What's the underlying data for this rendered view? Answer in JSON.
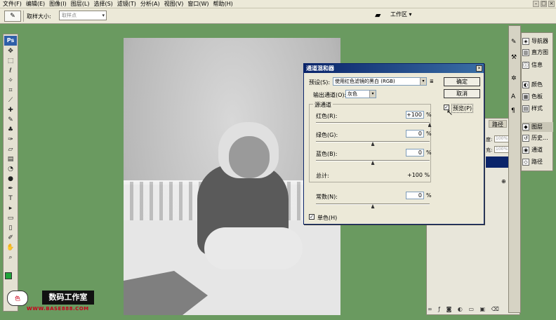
{
  "menu": {
    "items": [
      "文件(F)",
      "编辑(E)",
      "图像(I)",
      "图层(L)",
      "选择(S)",
      "滤镜(T)",
      "分析(A)",
      "视图(V)",
      "窗口(W)",
      "帮助(H)"
    ]
  },
  "options_bar": {
    "sample_label": "取样大小:",
    "sample_value": "取样点",
    "workspace_label": "工作区 ▾"
  },
  "toolbox": {
    "logo": "Ps",
    "foreground_color": "#1fa33a"
  },
  "watermark": {
    "text": "数码工作室",
    "url": "WWW.BASE888.COM",
    "logo": "色"
  },
  "layers_panel": {
    "tab_paths": "路径",
    "opacity_value": "100%",
    "fill_value": "100%",
    "opacity_label": "度:",
    "fill_label": "充:"
  },
  "dock": {
    "items": [
      {
        "label": "导航器",
        "icon": "navigator-icon",
        "glyph": "◈"
      },
      {
        "label": "直方图",
        "icon": "histogram-icon",
        "glyph": "▥"
      },
      {
        "label": "信息",
        "icon": "info-icon",
        "glyph": "ⓘ"
      },
      {
        "label": "颜色",
        "icon": "color-icon",
        "glyph": "◐"
      },
      {
        "label": "色板",
        "icon": "swatches-icon",
        "glyph": "▦"
      },
      {
        "label": "样式",
        "icon": "styles-icon",
        "glyph": "▤"
      },
      {
        "label": "图层",
        "icon": "layers-icon",
        "glyph": "◆"
      },
      {
        "label": "历史...",
        "icon": "history-icon",
        "glyph": "↺"
      },
      {
        "label": "通道",
        "icon": "channels-icon",
        "glyph": "◉"
      },
      {
        "label": "路径",
        "icon": "paths-icon",
        "glyph": "◇"
      }
    ]
  },
  "dialog": {
    "title": "通道混和器",
    "close": "×",
    "preset_label": "预设(S):",
    "preset_value": "使用红色滤镜的黑白 (RGB)",
    "output_label": "输出通道(O):",
    "output_value": "灰色",
    "source_label": "源通道",
    "red_label": "红色(R):",
    "red_value": "+100",
    "green_label": "绿色(G):",
    "green_value": "0",
    "blue_label": "蓝色(B):",
    "blue_value": "0",
    "total_label": "总计:",
    "total_value": "+100 %",
    "constant_label": "常数(N):",
    "constant_value": "0",
    "percent": "%",
    "monochrome_label": "单色(H)",
    "monochrome_checked": true,
    "ok_label": "确定",
    "cancel_label": "取消",
    "preview_label": "预览(P)",
    "preview_checked": true,
    "red_slider": 1.0,
    "green_slider": 0.5,
    "blue_slider": 0.5,
    "constant_slider": 0.5
  }
}
